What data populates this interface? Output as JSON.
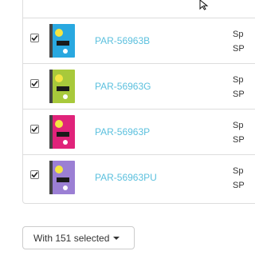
{
  "rows": [
    {
      "checked": true,
      "sku": "PAR-56963B",
      "product_line1": "Sp",
      "product_line2": "SP",
      "cover_color": "#29a8e0"
    },
    {
      "checked": true,
      "sku": "PAR-56963G",
      "product_line1": "Sp",
      "product_line2": "SP",
      "cover_color": "#a8c93b"
    },
    {
      "checked": true,
      "sku": "PAR-56963P",
      "product_line1": "Sp",
      "product_line2": "SP",
      "cover_color": "#e0237a"
    },
    {
      "checked": true,
      "sku": "PAR-56963PU",
      "product_line1": "Sp",
      "product_line2": "SP",
      "cover_color": "#9b7fd4"
    }
  ],
  "top_row": {
    "product_line2": "SP",
    "cover_color": "#9b7fd4"
  },
  "bulk_action": {
    "label": "With 151 selected",
    "icon": "caret-down-icon"
  },
  "colors": {
    "link": "#5bc0de",
    "border": "#dddddd",
    "text": "#333333"
  }
}
